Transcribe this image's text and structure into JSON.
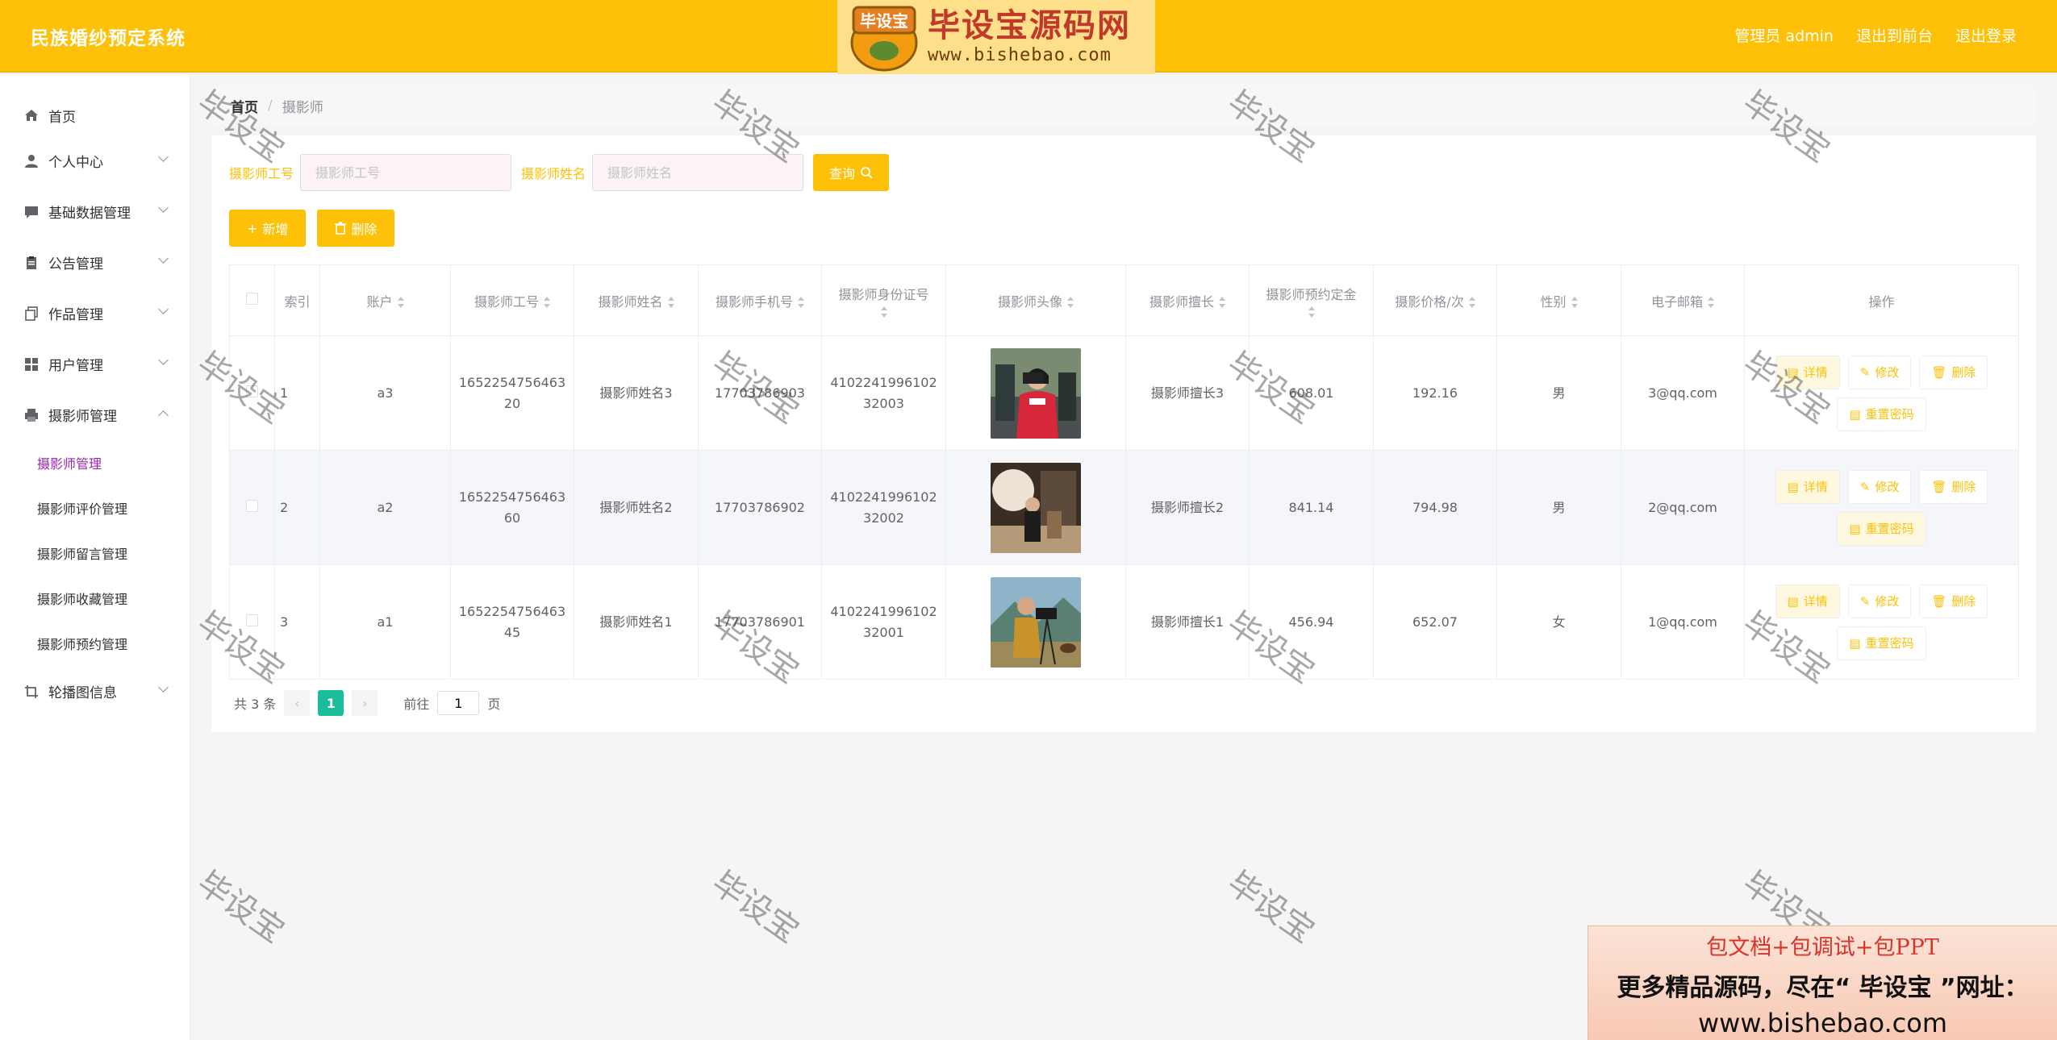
{
  "header": {
    "title": "民族婚纱预定系统",
    "admin_label": "管理员 admin",
    "front_link": "退出到前台",
    "logout_link": "退出登录"
  },
  "logo": {
    "seal_text": "毕设宝",
    "main_text": "毕设宝源码网",
    "url_text": "www.bishebao.com"
  },
  "sidebar": {
    "items": [
      {
        "label": "首页",
        "icon": "home-icon"
      },
      {
        "label": "个人中心",
        "icon": "user-icon"
      },
      {
        "label": "基础数据管理",
        "icon": "message-icon"
      },
      {
        "label": "公告管理",
        "icon": "clipboard-icon"
      },
      {
        "label": "作品管理",
        "icon": "copy-icon"
      },
      {
        "label": "用户管理",
        "icon": "grid-icon"
      },
      {
        "label": "摄影师管理",
        "icon": "printer-icon"
      },
      {
        "label": "轮播图信息",
        "icon": "crop-icon"
      }
    ],
    "sub_items": [
      "摄影师管理",
      "摄影师评价管理",
      "摄影师留言管理",
      "摄影师收藏管理",
      "摄影师预约管理"
    ]
  },
  "breadcrumb": {
    "home": "首页",
    "sep": "/",
    "current": "摄影师"
  },
  "search": {
    "label1": "摄影师工号",
    "placeholder1": "摄影师工号",
    "label2": "摄影师姓名",
    "placeholder2": "摄影师姓名",
    "query_button": "查询"
  },
  "actions": {
    "add": "新增",
    "delete": "删除"
  },
  "table": {
    "headers": [
      "索引",
      "账户",
      "摄影师工号",
      "摄影师姓名",
      "摄影师手机号",
      "摄影师身份证号",
      "摄影师头像",
      "摄影师擅长",
      "摄影师预约定金",
      "摄影价格/次",
      "性别",
      "电子邮箱",
      "操作"
    ],
    "rows": [
      {
        "index": "1",
        "account": "a3",
        "number": "165225475646320",
        "name": "摄影师姓名3",
        "phone": "17703786903",
        "id_card": "410224199610232003",
        "specialty": "摄影师擅长3",
        "deposit": "608.01",
        "price": "192.16",
        "gender": "男",
        "email": "3@qq.com"
      },
      {
        "index": "2",
        "account": "a2",
        "number": "165225475646360",
        "name": "摄影师姓名2",
        "phone": "17703786902",
        "id_card": "410224199610232002",
        "specialty": "摄影师擅长2",
        "deposit": "841.14",
        "price": "794.98",
        "gender": "男",
        "email": "2@qq.com"
      },
      {
        "index": "3",
        "account": "a1",
        "number": "165225475646345",
        "name": "摄影师姓名1",
        "phone": "17703786901",
        "id_card": "410224199610232001",
        "specialty": "摄影师擅长1",
        "deposit": "456.94",
        "price": "652.07",
        "gender": "女",
        "email": "1@qq.com"
      }
    ],
    "op_labels": {
      "detail": "详情",
      "edit": "修改",
      "delete": "删除",
      "reset": "重置密码"
    }
  },
  "pagination": {
    "total": "共 3 条",
    "page": "1",
    "goto_prefix": "前往",
    "goto_value": "1",
    "goto_suffix": "页"
  },
  "watermark": "毕设宝",
  "ad": {
    "line1": "包文档+包调试+包PPT",
    "line2": "更多精品源码，尽在“ 毕设宝 ”网址：",
    "line3": "www.bishebao.com"
  },
  "colors": {
    "accent": "#ffc107",
    "active_sub": "#9b27b0",
    "page_active": "#1abc9c"
  }
}
